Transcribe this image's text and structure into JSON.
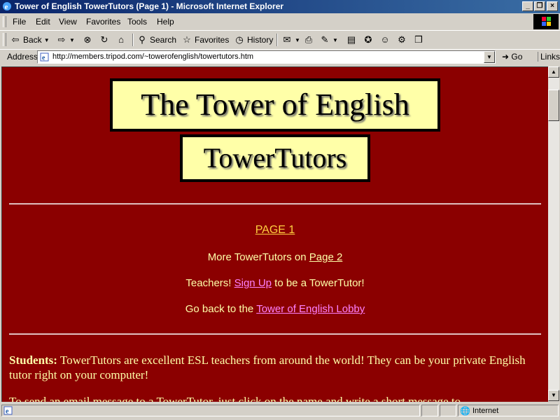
{
  "window": {
    "title": "Tower of English TowerTutors (Page 1) - Microsoft Internet Explorer"
  },
  "menu": [
    "File",
    "Edit",
    "View",
    "Favorites",
    "Tools",
    "Help"
  ],
  "toolbar": {
    "back": "Back",
    "search": "Search",
    "favorites": "Favorites",
    "history": "History"
  },
  "address": {
    "label": "Address",
    "url": "http://members.tripod.com/~towerofenglish/towertutors.htm",
    "go": "Go",
    "links": "Links"
  },
  "page": {
    "banner_title": "The Tower of English",
    "banner_subtitle": "TowerTutors",
    "page_label": "PAGE 1",
    "more_prefix": "More TowerTutors on ",
    "more_link": "Page 2",
    "teachers_prefix": "Teachers! ",
    "signup_link": "Sign Up",
    "teachers_suffix": " to be a TowerTutor!",
    "back_prefix": "Go back to the ",
    "lobby_link": "Tower of English Lobby",
    "students_label": "Students:",
    "students_text": " TowerTutors are excellent ESL teachers from around the world! They can be your private English tutor right on your computer!",
    "email_text": "To send an email message to a TowerTutor, just click on the name and write a short message to"
  },
  "status": {
    "zone": "Internet"
  }
}
